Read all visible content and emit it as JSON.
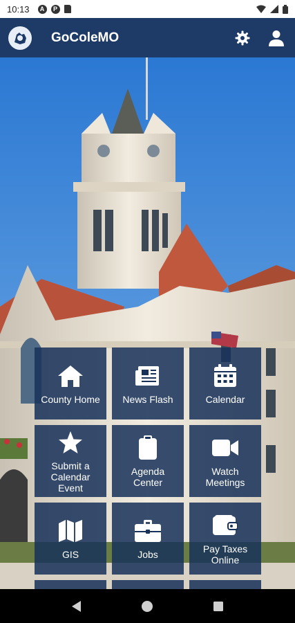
{
  "status_bar": {
    "time": "10:13",
    "notification_icons": [
      "a-circle-icon",
      "p-circle-icon",
      "sd-card-icon"
    ],
    "system_icons": [
      "wifi-icon",
      "signal-icon",
      "battery-icon"
    ]
  },
  "header": {
    "title": "GoColeMO",
    "actions": [
      "settings-gear-icon",
      "profile-icon"
    ]
  },
  "colors": {
    "header_bg": "#1d3b66",
    "tile_bg": "#18325a",
    "sky": "#2f7fd6"
  },
  "tiles": [
    {
      "label": "County Home",
      "icon": "home-icon"
    },
    {
      "label": "News Flash",
      "icon": "newspaper-icon"
    },
    {
      "label": "Calendar",
      "icon": "calendar-icon"
    },
    {
      "label": "Submit a\nCalendar\nEvent",
      "icon": "star-icon"
    },
    {
      "label": "Agenda\nCenter",
      "icon": "clipboard-icon"
    },
    {
      "label": "Watch\nMeetings",
      "icon": "video-camera-icon"
    },
    {
      "label": "GIS",
      "icon": "map-icon"
    },
    {
      "label": "Jobs",
      "icon": "briefcase-icon"
    },
    {
      "label": "Pay Taxes\nOnline",
      "icon": "wallet-icon"
    }
  ],
  "nav_bar": [
    "back-icon",
    "home-circle-icon",
    "recents-icon"
  ]
}
